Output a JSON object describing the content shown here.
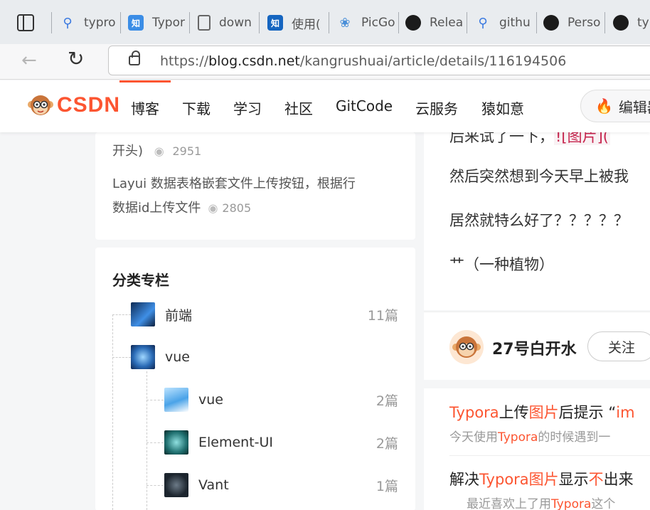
{
  "browser": {
    "tabs": [
      {
        "title": "typro",
        "icon": "search-icon"
      },
      {
        "title": "Typor",
        "icon": "zhihu-icon"
      },
      {
        "title": "down",
        "icon": "document-icon"
      },
      {
        "title": "使用(",
        "icon": "zhihu-icon"
      },
      {
        "title": "PicGo",
        "icon": "picgo-icon"
      },
      {
        "title": "Relea",
        "icon": "github-icon"
      },
      {
        "title": "githu",
        "icon": "search-icon"
      },
      {
        "title": "Perso",
        "icon": "github-icon"
      },
      {
        "title": "ty",
        "icon": "github-icon"
      }
    ],
    "url_prefix": "https://",
    "url_domain": "blog.csdn.net",
    "url_path": "/kangrushuai/article/details/116194506"
  },
  "csdn_nav": {
    "logo": "CSDN",
    "items": [
      "博客",
      "下载",
      "学习",
      "社区",
      "GitCode",
      "云服务",
      "猿如意"
    ],
    "editor_label": "编辑器"
  },
  "hot_articles": [
    {
      "title": "开头)",
      "views": "2951"
    },
    {
      "title_line1": "Layui 数据表格嵌套文件上传按钮，根据行",
      "title_line2": "数据id上传文件",
      "views": "2805"
    }
  ],
  "categories": {
    "title": "分类专栏",
    "items": [
      {
        "name": "前端",
        "count": "11篇",
        "level": 0
      },
      {
        "name": "vue",
        "count": "",
        "level": 0
      },
      {
        "name": "vue",
        "count": "2篇",
        "level": 1
      },
      {
        "name": "Element-UI",
        "count": "2篇",
        "level": 1
      },
      {
        "name": "Vant",
        "count": "1篇",
        "level": 1
      }
    ]
  },
  "article": {
    "line1": "后来试了一下，",
    "line1_code": "![图片](",
    "line2": "然后突然想到今天早上被我",
    "line3": "居然就特么好了？？？？？",
    "line4": "艹（一种植物）"
  },
  "author": {
    "name": "27号白开水",
    "follow_label": "关注"
  },
  "related": [
    {
      "title_parts": [
        "Typora",
        "上传",
        "图片",
        "后提示 “",
        "im"
      ],
      "desc_parts": [
        "今天使用",
        "Typora",
        "的时候遇到一"
      ]
    },
    {
      "title_parts": [
        "解决",
        "Typora",
        "图片",
        "显示",
        "不",
        "出来"
      ],
      "desc_parts": [
        "最近喜欢上了用",
        "Typora",
        "这个"
      ]
    }
  ],
  "colors": {
    "accent": "#fc5531"
  }
}
